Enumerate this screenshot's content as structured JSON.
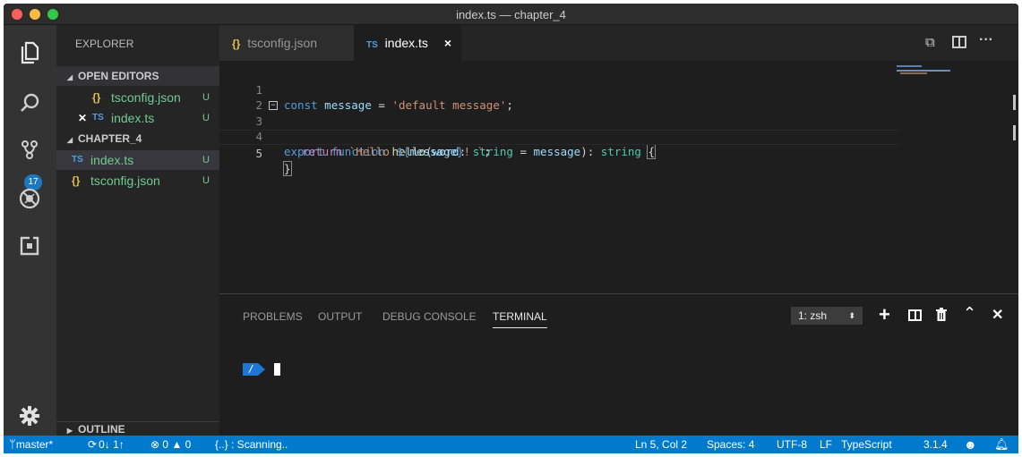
{
  "window": {
    "title": "index.ts — chapter_4"
  },
  "activity_bar": {
    "badge_count": "17"
  },
  "sidebar": {
    "title": "EXPLORER",
    "open_editors": {
      "header": "OPEN EDITORS",
      "items": [
        {
          "icon": "{}",
          "name": "tsconfig.json",
          "status": "U"
        },
        {
          "icon": "TS",
          "name": "index.ts",
          "status": "U"
        }
      ]
    },
    "project": {
      "header": "CHAPTER_4",
      "items": [
        {
          "icon": "TS",
          "name": "index.ts",
          "status": "U"
        },
        {
          "icon": "{}",
          "name": "tsconfig.json",
          "status": "U"
        }
      ]
    },
    "outline_header": "OUTLINE"
  },
  "tabs": [
    {
      "icon": "{}",
      "label": "tsconfig.json"
    },
    {
      "icon": "TS",
      "label": "index.ts",
      "close": "×"
    }
  ],
  "editor": {
    "line_numbers": [
      "1",
      "2",
      "3",
      "4",
      "5"
    ]
  },
  "panel": {
    "tabs": [
      "PROBLEMS",
      "OUTPUT",
      "DEBUG CONSOLE",
      "TERMINAL"
    ],
    "terminal_select": "1: zsh",
    "prompt_path": "/"
  },
  "status_bar": {
    "branch": "master*",
    "sync": "0↓ 1↑",
    "errors": "0",
    "warnings": "0",
    "scanning": "{..} : Scanning..",
    "position": "Ln 5, Col 2",
    "spaces": "Spaces: 4",
    "encoding": "UTF-8",
    "eol": "LF",
    "language": "TypeScript",
    "version": "3.1.4"
  },
  "colors": {
    "accent_blue": "#007acc",
    "badge_blue": "#1c78c0",
    "untracked_green": "#73c991",
    "json_yellow": "#e0c24c",
    "ts_blue": "#4aa0e6"
  }
}
